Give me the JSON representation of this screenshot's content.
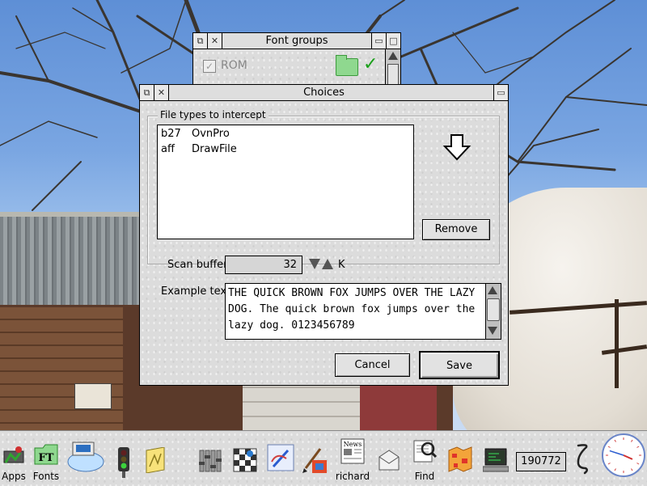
{
  "font_groups_window": {
    "title": "Font groups",
    "items": [
      {
        "label": "ROM",
        "checked": true,
        "enabled": false,
        "folder_icon": "folder-icon",
        "tick_icon": "tick-icon"
      }
    ]
  },
  "choices_window": {
    "title": "Choices",
    "filetypes_label": "File types to intercept",
    "filetypes": [
      {
        "code": "b27",
        "name": "OvnPro"
      },
      {
        "code": "aff",
        "name": "DrawFile"
      }
    ],
    "remove_label": "Remove",
    "scan_buffer_label": "Scan buffer",
    "scan_buffer_value": "32",
    "scan_buffer_unit": "K",
    "example_text_label": "Example text",
    "example_text": "THE QUICK BROWN FOX JUMPS OVER THE LAZY DOG. The quick brown fox jumps over the lazy dog. 0123456789",
    "cancel_label": "Cancel",
    "save_label": "Save"
  },
  "iconbar": {
    "items": [
      {
        "label": "Apps",
        "icon": "apps-icon"
      },
      {
        "label": "Fonts",
        "icon": "fonts-icon"
      },
      {
        "label": "",
        "icon": "network-drive-icon"
      },
      {
        "label": "",
        "icon": "traffic-light-icon"
      },
      {
        "label": "",
        "icon": "notepad-icon"
      },
      {
        "label": "",
        "icon": "audio-mixer-icon"
      },
      {
        "label": "",
        "icon": "chess-icon"
      },
      {
        "label": "",
        "icon": "draw-icon"
      },
      {
        "label": "",
        "icon": "paint-icon"
      },
      {
        "label": "richard",
        "icon": "news-icon"
      },
      {
        "label": "",
        "icon": "mail-icon"
      },
      {
        "label": "Find",
        "icon": "find-icon"
      },
      {
        "label": "",
        "icon": "maps-icon"
      },
      {
        "label": "",
        "icon": "task-manager-icon"
      }
    ],
    "free_memory": "190772",
    "clock_time": {
      "hour": 3,
      "minute": 48
    }
  },
  "colors": {
    "window_bg": "#dcdcdc",
    "folder_green": "#8fd88f",
    "tick_green": "#1aa01a",
    "clock_ring": "#6a85c8"
  }
}
